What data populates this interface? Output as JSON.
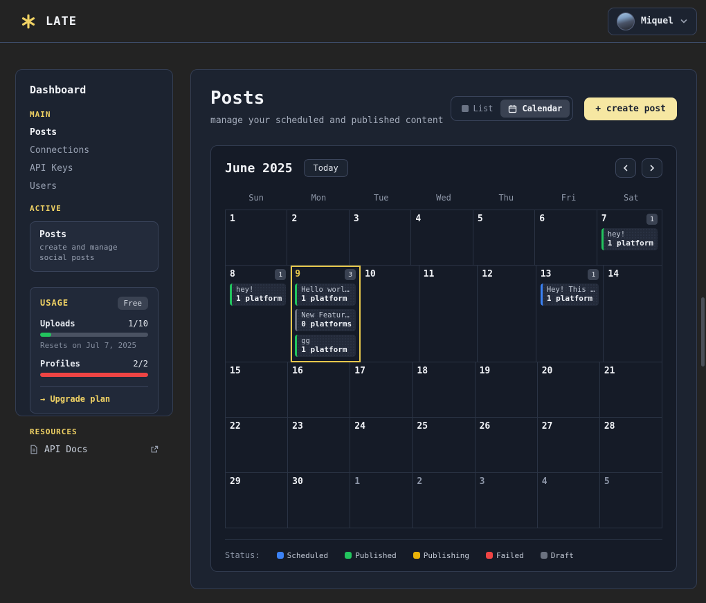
{
  "header": {
    "brand": "LATE",
    "user_name": "Miquel"
  },
  "sidebar": {
    "title": "Dashboard",
    "main_label": "MAIN",
    "nav_items": [
      {
        "label": "Posts",
        "active": true
      },
      {
        "label": "Connections",
        "active": false
      },
      {
        "label": "API Keys",
        "active": false
      },
      {
        "label": "Users",
        "active": false
      }
    ],
    "active_label": "ACTIVE",
    "active_card": {
      "title": "Posts",
      "description": "create and manage social posts"
    },
    "usage": {
      "title": "USAGE",
      "badge": "Free",
      "meters": [
        {
          "label": "Uploads",
          "value": "1/10",
          "percent": 10,
          "color": "#22c55e",
          "note": "Resets on Jul 7, 2025"
        },
        {
          "label": "Profiles",
          "value": "2/2",
          "percent": 100,
          "color": "#ef4444",
          "note": ""
        }
      ],
      "upgrade_label": "→ Upgrade plan"
    },
    "resources_label": "RESOURCES",
    "resources_item": "API Docs"
  },
  "main": {
    "title": "Posts",
    "subtitle": "manage your scheduled and published content",
    "toggle": {
      "list_label": "List",
      "calendar_label": "Calendar",
      "active": "Calendar"
    },
    "create_button_label": "+ create post"
  },
  "calendar": {
    "month_title": "June 2025",
    "today_label": "Today",
    "day_headers": [
      "Sun",
      "Mon",
      "Tue",
      "Wed",
      "Thu",
      "Fri",
      "Sat"
    ],
    "status_colors": {
      "scheduled": "#3b82f6",
      "published": "#22c55e",
      "publishing": "#eab308",
      "failed": "#ef4444",
      "draft": "#6b7280"
    },
    "weeks": [
      [
        {
          "day": "1"
        },
        {
          "day": "2"
        },
        {
          "day": "3"
        },
        {
          "day": "4"
        },
        {
          "day": "5"
        },
        {
          "day": "6"
        },
        {
          "day": "7",
          "count": "1",
          "events": [
            {
              "title": "hey!",
              "platforms": "1 platform",
              "status": "published"
            }
          ]
        }
      ],
      [
        {
          "day": "8",
          "count": "1",
          "events": [
            {
              "title": "hey!",
              "platforms": "1 platform",
              "status": "published"
            }
          ]
        },
        {
          "day": "9",
          "today": true,
          "count": "3",
          "events": [
            {
              "title": "Hello worl…",
              "platforms": "1 platform",
              "status": "published"
            },
            {
              "title": "New Featur…",
              "platforms": "0 platforms",
              "status": "draft"
            },
            {
              "title": "gg",
              "platforms": "1 platform",
              "status": "published"
            }
          ]
        },
        {
          "day": "10"
        },
        {
          "day": "11"
        },
        {
          "day": "12"
        },
        {
          "day": "13",
          "count": "1",
          "events": [
            {
              "title": "Hey! This …",
              "platforms": "1 platform",
              "status": "scheduled"
            }
          ]
        },
        {
          "day": "14"
        }
      ],
      [
        {
          "day": "15"
        },
        {
          "day": "16"
        },
        {
          "day": "17"
        },
        {
          "day": "18"
        },
        {
          "day": "19"
        },
        {
          "day": "20"
        },
        {
          "day": "21"
        }
      ],
      [
        {
          "day": "22"
        },
        {
          "day": "23"
        },
        {
          "day": "24"
        },
        {
          "day": "25"
        },
        {
          "day": "26"
        },
        {
          "day": "27"
        },
        {
          "day": "28"
        }
      ],
      [
        {
          "day": "29"
        },
        {
          "day": "30"
        },
        {
          "day": "1",
          "outside": true
        },
        {
          "day": "2",
          "outside": true
        },
        {
          "day": "3",
          "outside": true
        },
        {
          "day": "4",
          "outside": true
        },
        {
          "day": "5",
          "outside": true
        }
      ]
    ],
    "legend_label": "Status:",
    "legend_items": [
      {
        "label": "Scheduled",
        "color": "#3b82f6"
      },
      {
        "label": "Published",
        "color": "#22c55e"
      },
      {
        "label": "Publishing",
        "color": "#eab308"
      },
      {
        "label": "Failed",
        "color": "#ef4444"
      },
      {
        "label": "Draft",
        "color": "#6b7280"
      }
    ]
  }
}
